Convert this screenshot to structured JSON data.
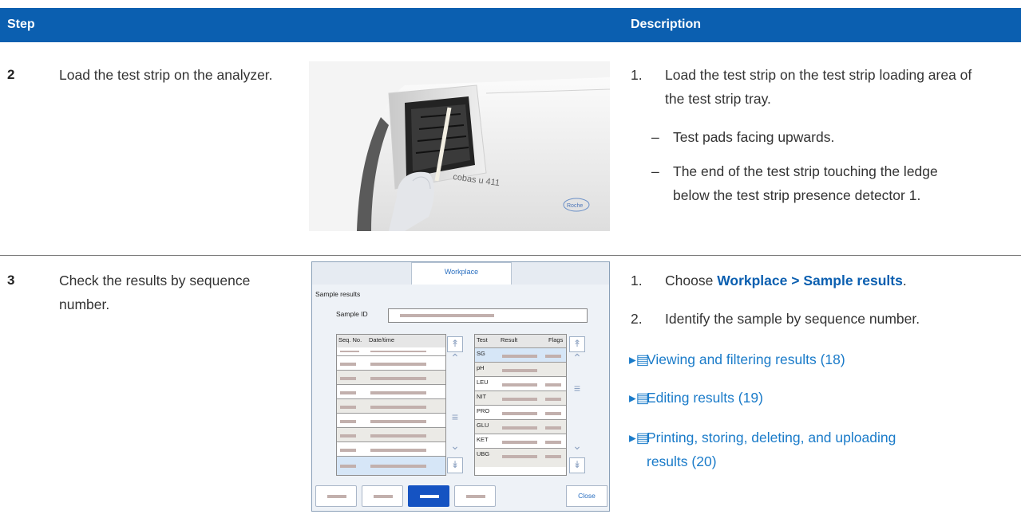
{
  "header": {
    "step": "Step",
    "description": "Description"
  },
  "rows": [
    {
      "num": "2",
      "text": "Load the test strip on the analyzer.",
      "items": [
        {
          "n": "1.",
          "text": "Load the test strip on the test strip loading area of the test strip tray."
        }
      ],
      "subitems": [
        {
          "d": "–",
          "text": "Test pads facing upwards."
        },
        {
          "d": "–",
          "text": "The end of the test strip touching the ledge below the test strip presence detector 1."
        }
      ],
      "photo_label": "cobas u 411",
      "photo_brand": "Roche"
    },
    {
      "num": "3",
      "text": "Check the results by sequence number.",
      "items": [
        {
          "n": "1.",
          "prefix": "Choose ",
          "link": "Workplace > Sample results",
          "suffix": "."
        },
        {
          "n": "2.",
          "text": "Identify the sample by sequence number."
        }
      ],
      "refs": [
        "Viewing and filtering results (18)",
        "Editing results (19)",
        "Printing, storing, deleting, and uploading results (20)"
      ]
    }
  ],
  "screen": {
    "tab": "Workplace",
    "title": "Sample results",
    "sample_id_label": "Sample ID",
    "left_headers": [
      "Seq. No.",
      "Date/time"
    ],
    "right_headers": [
      "Test",
      "Result",
      "Flags"
    ],
    "tests": [
      "SG",
      "pH",
      "LEU",
      "NIT",
      "PRO",
      "GLU",
      "KET",
      "UBG"
    ],
    "close": "Close"
  },
  "colors": {
    "header_bg": "#0b5fb0",
    "link": "#1a7bc9",
    "accent_button": "#1553c2"
  }
}
